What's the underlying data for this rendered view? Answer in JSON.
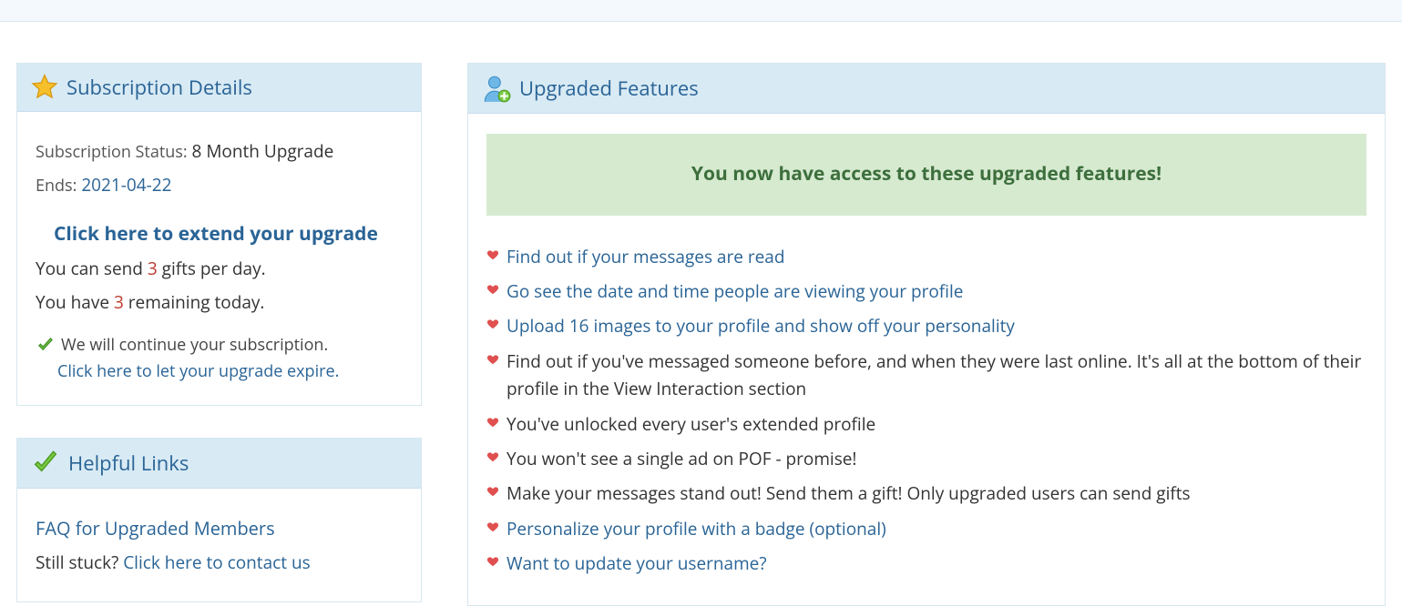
{
  "subscription": {
    "header": "Subscription Details",
    "status_label": "Subscription Status:",
    "status_value": "8 Month Upgrade",
    "ends_label": "Ends:",
    "ends_value": "2021-04-22",
    "extend_link": "Click here to extend your upgrade",
    "gifts_pre": "You can send ",
    "gifts_per_day": "3",
    "gifts_post": " gifts per day.",
    "remaining_pre": "You have ",
    "remaining_count": "3",
    "remaining_post": " remaining today.",
    "continue_text": "We will continue your subscription.",
    "expire_link": "Click here to let your upgrade expire."
  },
  "helpful": {
    "header": "Helpful Links",
    "faq_link": "FAQ for Upgraded Members",
    "stuck_pre": "Still stuck? ",
    "stuck_link": "Click here to contact us"
  },
  "features": {
    "header": "Upgraded Features",
    "banner": "You now have access to these upgraded features!",
    "items": [
      {
        "text": "Find out if your messages are read",
        "link": true
      },
      {
        "text": "Go see the date and time people are viewing your profile",
        "link": true
      },
      {
        "text": "Upload 16 images to your profile and show off your personality",
        "link": true
      },
      {
        "text": "Find out if you've messaged someone before, and when they were last online. It's all at the bottom of their profile in the View Interaction section",
        "link": false
      },
      {
        "text": "You've unlocked every user's extended profile",
        "link": false
      },
      {
        "text": "You won't see a single ad on POF - promise!",
        "link": false
      },
      {
        "text": "Make your messages stand out! Send them a gift! Only upgraded users can send gifts",
        "link": false
      },
      {
        "text": "Personalize your profile with a badge (optional)",
        "link": true
      },
      {
        "text": "Want to update your username?",
        "link": true
      }
    ]
  }
}
